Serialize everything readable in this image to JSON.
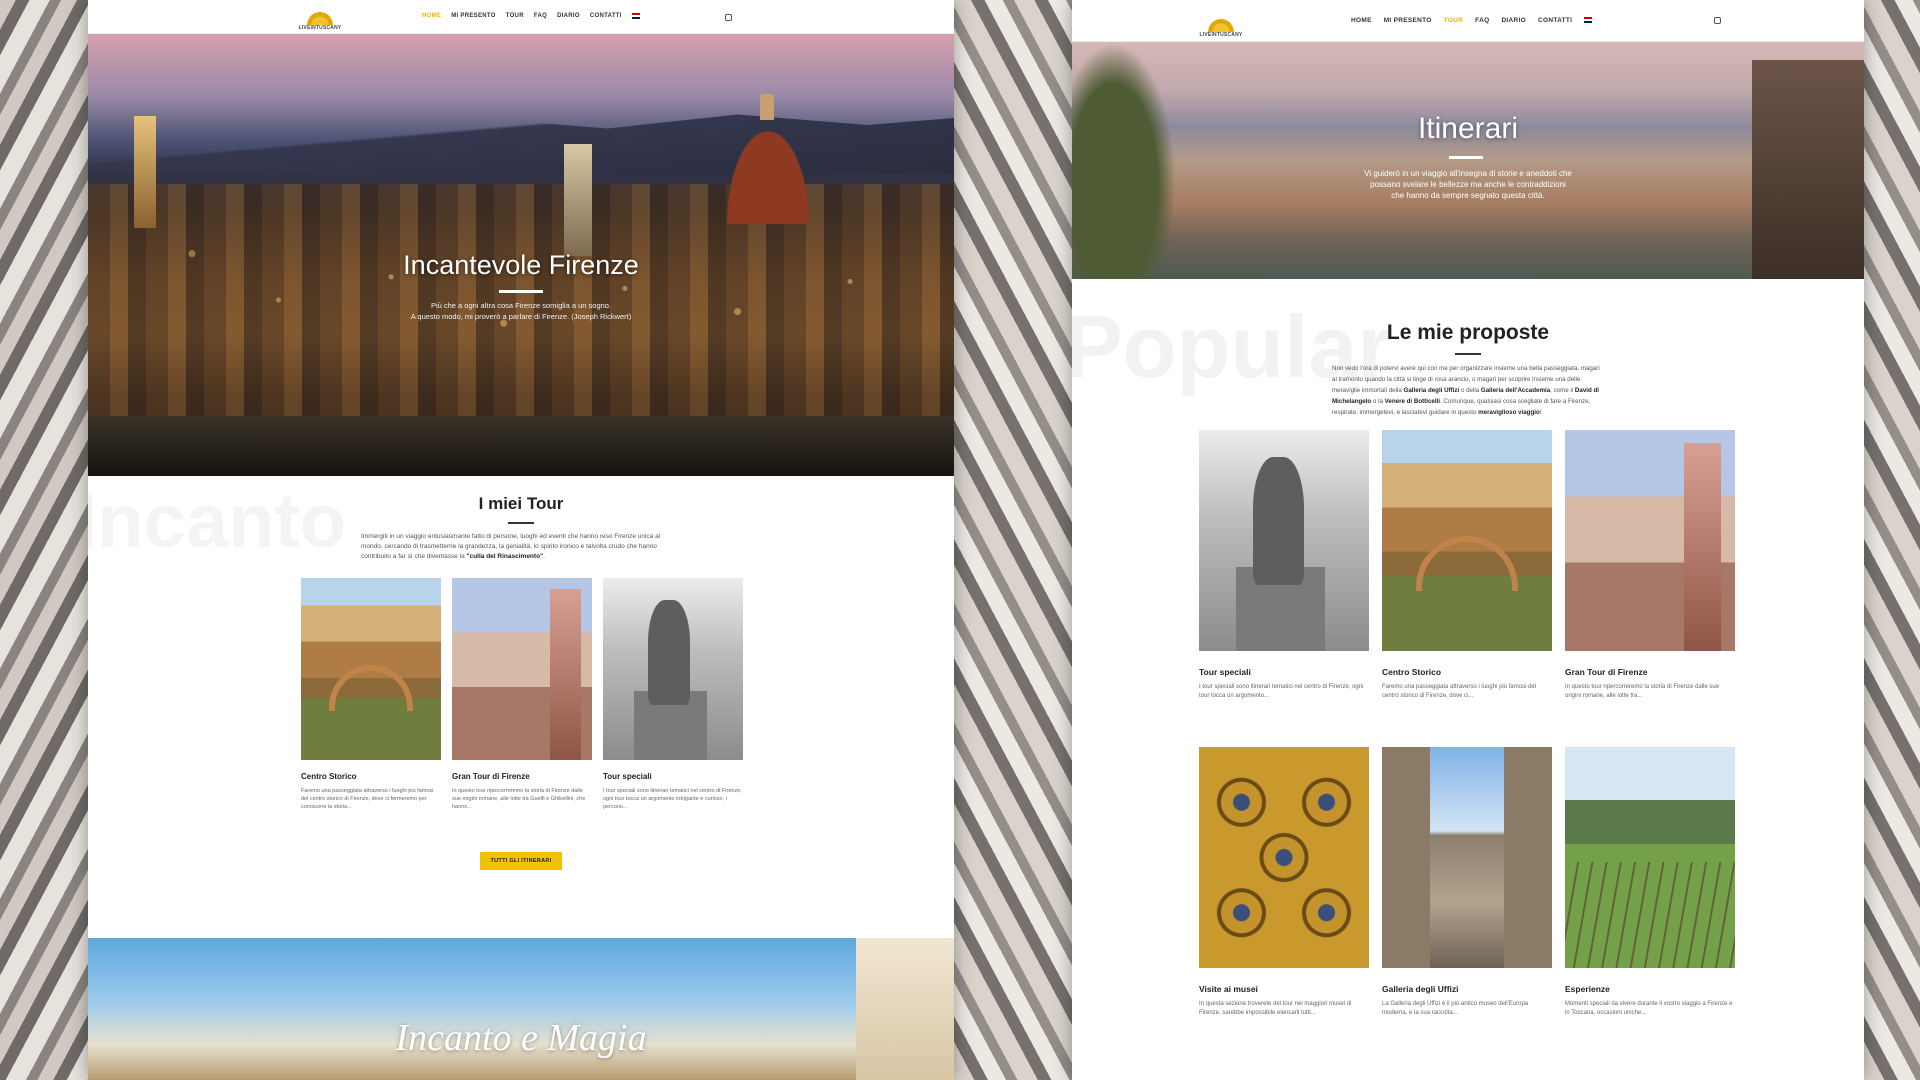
{
  "nav_left": {
    "logo_text": "LIVEINTUSCANY",
    "items": [
      "HOME",
      "MI PRESENTO",
      "TOUR",
      "FAQ",
      "DIARIO",
      "CONTATTI"
    ],
    "active": "HOME"
  },
  "nav_right": {
    "logo_text": "LIVEINTUSCANY",
    "items": [
      "HOME",
      "MI PRESENTO",
      "TOUR",
      "FAQ",
      "DIARIO",
      "CONTATTI"
    ],
    "active": "TOUR"
  },
  "left": {
    "hero_title": "Incantevole Firenze",
    "hero_sub_line1": "Più che a ogni altra cosa Firenze somiglia a un sogno.",
    "hero_sub_line2": "A questo modo, mi proverò a parlare di Firenze. (Joseph Rickwert)",
    "watermark": "Incanto",
    "section_title": "I miei Tour",
    "section_intro_a": "Immergiti in un viaggio entusiasmante fatto di persone, luoghi ed eventi che hanno reso Firenze unica al mondo, cercando di trasmetterne la grandezza, la genialità, lo spirito ironico e talvolta crudo che hanno contribuito a far sì che diventasse la ",
    "section_intro_b": "\"culla del Rinascimento\"",
    "section_intro_c": ".",
    "cards": [
      {
        "title": "Centro Storico",
        "text": "Faremo una passeggiata attraverso i luoghi più famosi del centro storico di Firenze, dove ci fermeremo per conoscere la storia..."
      },
      {
        "title": "Gran Tour di Firenze",
        "text": "In questo tour ripercorreremo la storia di Firenze dalle sue origini romane, alle lotte tra Guelfi e Ghibellini, che hanno..."
      },
      {
        "title": "Tour speciali",
        "text": "I tour speciali sono itinerari tematici nel centro di Firenze, ogni tour tocca un argomento intrigante e curioso, i percorsi..."
      }
    ],
    "button_label": "TUTTI GLI ITINERARI",
    "bottom_title": "Incanto e Magia"
  },
  "right": {
    "hero_title": "Itinerari",
    "hero_sub_line1": "Vi guiderò in un viaggio all'insegna di storie e aneddoti che",
    "hero_sub_line2": "possano svelare le bellezze ma anche le contraddizioni",
    "hero_sub_line3": "che hanno da sempre segnato questa città.",
    "watermark": "Popular",
    "section_title": "Le mie proposte",
    "intro_a": "Non vedo l'ora di potervi avere qui con me per organizzare insieme una bella passeggiata, magari al tramonto quando la città si tinge di rosa arancio, o magari per scoprire insieme una delle meraviglie immortali della ",
    "intro_b1": "Galleria degli Uffizi",
    "intro_c": " o della ",
    "intro_b2": "Galleria dell'Accademia",
    "intro_d": ", come il ",
    "intro_b3": "David di Michelangelo",
    "intro_e": " o la ",
    "intro_b4": "Venere di Botticelli",
    "intro_f": ". Comunque, qualsiasi cosa scegliate di fare a Firenze, respirate, immergetevi, e lasciatevi guidare in questo ",
    "intro_b5": "meraviglioso viaggio",
    "intro_g": "!",
    "cards_row1": [
      {
        "title": "Tour speciali",
        "text": "I tour speciali sono itinerari tematici nel centro di Firenze, ogni tour tocca un argomento..."
      },
      {
        "title": "Centro Storico",
        "text": "Faremo una passeggiata attraverso i luoghi più famosi del centro storico di Firenze, dove ci..."
      },
      {
        "title": "Gran Tour di Firenze",
        "text": "In questo tour ripercorreremo la storia di Firenze dalle sue origini romane, alle lotte tra..."
      }
    ],
    "cards_row2": [
      {
        "title": "Visite ai musei",
        "text": "In questa sezione troverete dei tour nei maggiori musei di Firenze, sarebbe impossibile elencarli tutti..."
      },
      {
        "title": "Galleria degli Uffizi",
        "text": "La Galleria degli Uffizi è il più antico museo dell'Europa moderna, e la sua raccolta..."
      },
      {
        "title": "Esperienze",
        "text": "Momenti speciali da vivere durante il vostro viaggio a Firenze e in Toscana, occasioni uniche..."
      }
    ]
  }
}
